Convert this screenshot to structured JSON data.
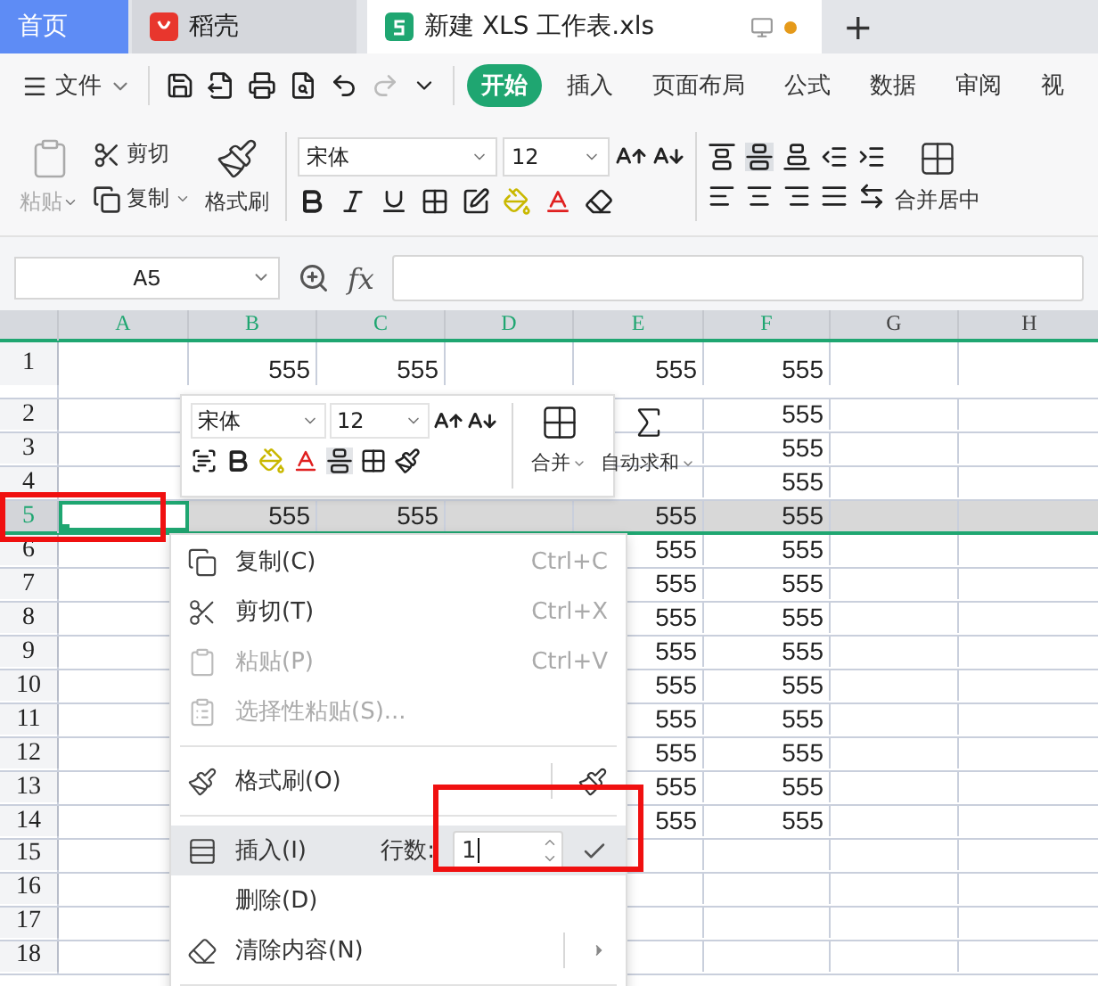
{
  "tabs": [
    {
      "label": "首页",
      "kind": "home",
      "selected": false
    },
    {
      "label": "稻壳",
      "kind": "docer",
      "selected": false
    },
    {
      "label": "新建 XLS 工作表.xls",
      "kind": "sheet",
      "selected": true,
      "unsaved": true
    }
  ],
  "add_tab": "+",
  "menu": {
    "file": "文件",
    "tabs": [
      {
        "label": "开始",
        "selected": true
      },
      {
        "label": "插入",
        "selected": false
      },
      {
        "label": "页面布局",
        "selected": false
      },
      {
        "label": "公式",
        "selected": false
      },
      {
        "label": "数据",
        "selected": false
      },
      {
        "label": "审阅",
        "selected": false
      },
      {
        "label": "视",
        "selected": false
      }
    ]
  },
  "ribbon": {
    "paste": {
      "label": "粘贴",
      "disabled": true
    },
    "cut": "剪切",
    "copy": "复制",
    "format_painter": "格式刷",
    "font": "宋体",
    "size": "12",
    "merge": "合并居中"
  },
  "formula_bar": {
    "name_box": "A5",
    "fx": "fx"
  },
  "columns": [
    {
      "label": "A",
      "highlighted": true
    },
    {
      "label": "B",
      "highlighted": true
    },
    {
      "label": "C",
      "highlighted": true
    },
    {
      "label": "D",
      "highlighted": true
    },
    {
      "label": "E",
      "highlighted": true
    },
    {
      "label": "F",
      "highlighted": true
    },
    {
      "label": "G",
      "highlighted": false
    },
    {
      "label": "H",
      "highlighted": false
    }
  ],
  "rows": [
    {
      "number": "1",
      "selected": false,
      "cells": [
        null,
        "555",
        "555",
        null,
        "555",
        "555",
        null,
        null
      ]
    },
    {
      "number": "2",
      "selected": false,
      "cells": [
        null,
        null,
        null,
        null,
        null,
        "555",
        null,
        null
      ]
    },
    {
      "number": "3",
      "selected": false,
      "cells": [
        null,
        null,
        null,
        null,
        null,
        "555",
        null,
        null
      ]
    },
    {
      "number": "4",
      "selected": false,
      "cells": [
        null,
        null,
        null,
        null,
        null,
        "555",
        null,
        null
      ]
    },
    {
      "number": "5",
      "selected": true,
      "cells": [
        null,
        "555",
        "555",
        null,
        "555",
        "555",
        null,
        null
      ]
    },
    {
      "number": "6",
      "selected": false,
      "cells": [
        null,
        null,
        null,
        null,
        "555",
        "555",
        null,
        null
      ]
    },
    {
      "number": "7",
      "selected": false,
      "cells": [
        null,
        null,
        null,
        null,
        "555",
        "555",
        null,
        null
      ]
    },
    {
      "number": "8",
      "selected": false,
      "cells": [
        null,
        null,
        null,
        null,
        "555",
        "555",
        null,
        null
      ]
    },
    {
      "number": "9",
      "selected": false,
      "cells": [
        null,
        null,
        null,
        null,
        "555",
        "555",
        null,
        null
      ]
    },
    {
      "number": "10",
      "selected": false,
      "cells": [
        null,
        null,
        null,
        null,
        "555",
        "555",
        null,
        null
      ]
    },
    {
      "number": "11",
      "selected": false,
      "cells": [
        null,
        null,
        null,
        null,
        "555",
        "555",
        null,
        null
      ]
    },
    {
      "number": "12",
      "selected": false,
      "cells": [
        null,
        null,
        null,
        null,
        "555",
        "555",
        null,
        null
      ]
    },
    {
      "number": "13",
      "selected": false,
      "cells": [
        null,
        null,
        null,
        null,
        "555",
        "555",
        null,
        null
      ]
    },
    {
      "number": "14",
      "selected": false,
      "cells": [
        null,
        null,
        null,
        null,
        "555",
        "555",
        null,
        null
      ]
    },
    {
      "number": "15",
      "selected": false,
      "cells": [
        null,
        null,
        null,
        null,
        null,
        null,
        null,
        null
      ]
    },
    {
      "number": "16",
      "selected": false,
      "cells": [
        null,
        null,
        null,
        null,
        null,
        null,
        null,
        null
      ]
    },
    {
      "number": "17",
      "selected": false,
      "cells": [
        null,
        null,
        null,
        null,
        null,
        null,
        null,
        null
      ]
    },
    {
      "number": "18",
      "selected": false,
      "cells": [
        null,
        null,
        null,
        null,
        null,
        null,
        null,
        null
      ]
    }
  ],
  "mini_toolbar": {
    "font": "宋体",
    "size": "12",
    "merge": "合并",
    "autosum": "自动求和"
  },
  "context_menu": [
    {
      "kind": "item",
      "label": "复制(C)",
      "shortcut": "Ctrl+C",
      "disabled": false
    },
    {
      "kind": "item",
      "label": "剪切(T)",
      "shortcut": "Ctrl+X",
      "disabled": false
    },
    {
      "kind": "item",
      "label": "粘贴(P)",
      "shortcut": "Ctrl+V",
      "disabled": true
    },
    {
      "kind": "item",
      "label": "选择性粘贴(S)...",
      "disabled": true
    },
    {
      "kind": "separator"
    },
    {
      "kind": "item",
      "label": "格式刷(O)",
      "disabled": false,
      "side_icon": true
    },
    {
      "kind": "separator"
    },
    {
      "kind": "insert",
      "label": "插入(I)",
      "highlighted": true,
      "rows_label": "行数:",
      "rows_value": "1"
    },
    {
      "kind": "item",
      "label": "删除(D)",
      "disabled": false
    },
    {
      "kind": "item",
      "label": "清除内容(N)",
      "disabled": false,
      "submenu": true
    },
    {
      "kind": "separator"
    }
  ]
}
